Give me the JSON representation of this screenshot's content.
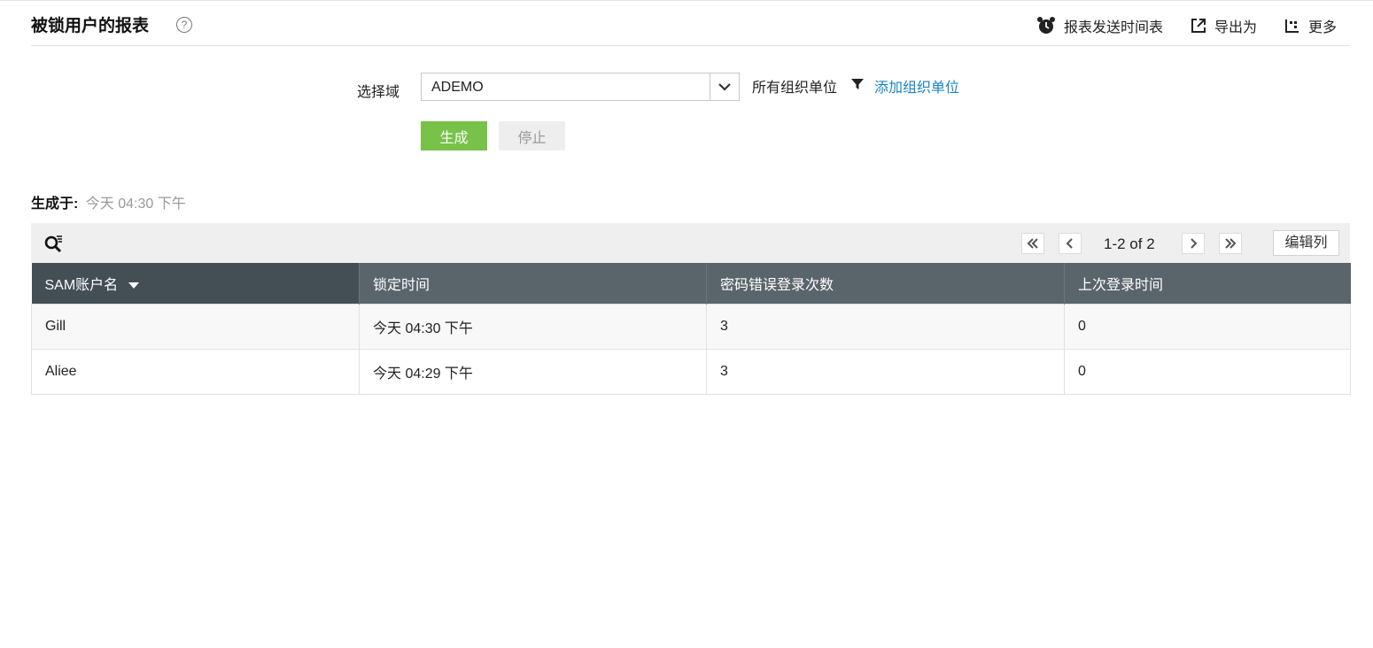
{
  "header": {
    "title": "被锁用户的报表",
    "help_icon": "question-circle-icon",
    "actions": [
      {
        "label": "报表发送时间表",
        "icon": "alarm-clock-icon"
      },
      {
        "label": "导出为",
        "icon": "export-icon"
      },
      {
        "label": "更多",
        "icon": "more-icon"
      }
    ]
  },
  "filters": {
    "domain_label": "选择域",
    "domain_value": "ADEMO",
    "ou_label": "所有组织单位",
    "add_ou_link": "添加组织单位"
  },
  "buttons": {
    "generate": "生成",
    "stop": "停止"
  },
  "generated": {
    "label": "生成于:",
    "value": "今天 04:30 下午"
  },
  "pagination": {
    "range": "1-2 of 2",
    "edit_columns": "编辑列"
  },
  "table": {
    "columns": [
      "SAM账户名",
      "锁定时间",
      "密码错误登录次数",
      "上次登录时间"
    ],
    "sorted_column": "SAM账户名",
    "rows": [
      {
        "sam": "Gill",
        "locked_time": "今天 04:30 下午",
        "bad_pwd_count": "3",
        "last_logon": "0"
      },
      {
        "sam": "Aliee",
        "locked_time": "今天 04:29 下午",
        "bad_pwd_count": "3",
        "last_logon": "0"
      }
    ]
  },
  "colors": {
    "generate_button": "#78c24a",
    "link": "#1b84c4",
    "table_header": "#5a646b",
    "table_header_sorted": "#434e55",
    "toolbar": "#efefef"
  }
}
